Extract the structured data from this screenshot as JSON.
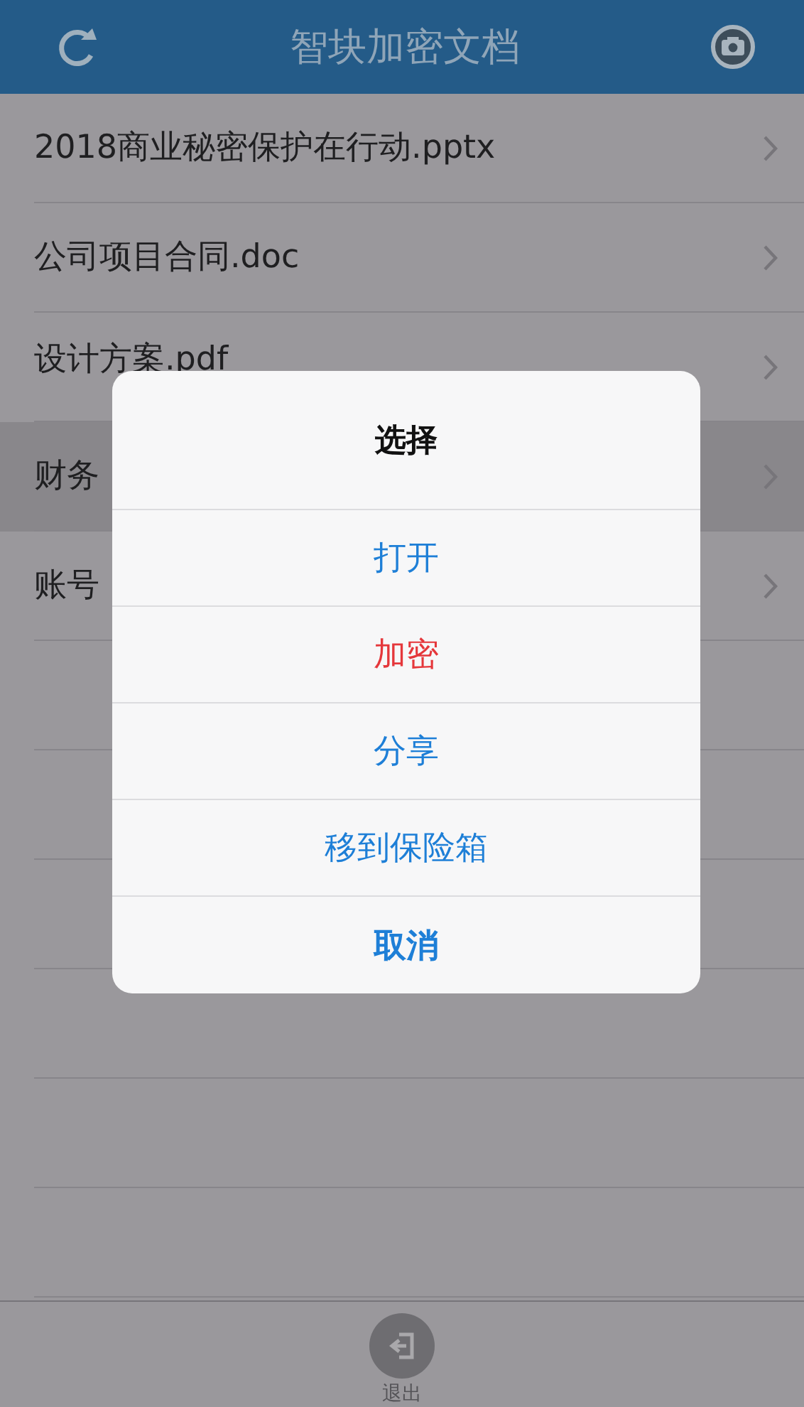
{
  "header": {
    "title": "智块加密文档"
  },
  "files": [
    {
      "name": "2018商业秘密保护在行动.pptx",
      "selected": false
    },
    {
      "name": "公司项目合同.doc",
      "selected": false
    },
    {
      "name": "设计方案.pdf",
      "selected": false
    },
    {
      "name": "财务",
      "selected": true
    },
    {
      "name": "账号",
      "selected": false
    }
  ],
  "dialog": {
    "title": "选择",
    "actions": [
      {
        "label": "打开",
        "kind": "default"
      },
      {
        "label": "加密",
        "kind": "destructive"
      },
      {
        "label": "分享",
        "kind": "default"
      },
      {
        "label": "移到保险箱",
        "kind": "default"
      },
      {
        "label": "取消",
        "kind": "cancel"
      }
    ]
  },
  "bottom_bar": {
    "label": "退出"
  }
}
